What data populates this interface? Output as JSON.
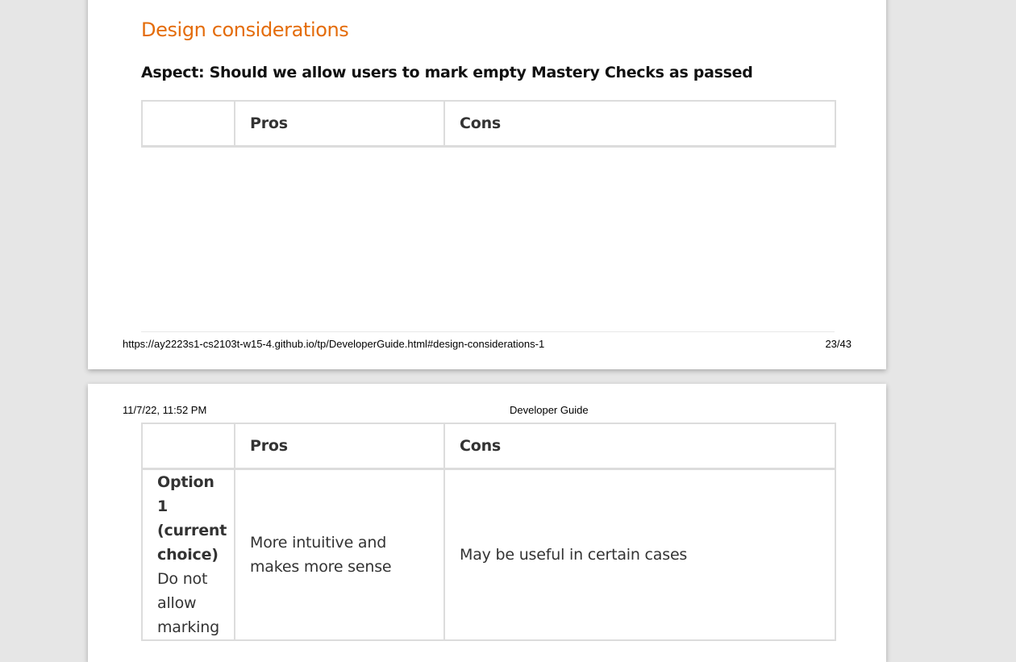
{
  "page1": {
    "section_heading": "Design considerations",
    "aspect_heading": "Aspect: Should we allow users to mark empty Mastery Checks as passed",
    "table_headers": [
      "",
      "Pros",
      "Cons"
    ],
    "footer_url": "https://ay2223s1-cs2103t-w15-4.github.io/tp/DeveloperGuide.html#design-considerations-1",
    "footer_page": "23/43"
  },
  "page2": {
    "header_date": "11/7/22, 11:52 PM",
    "header_title": "Developer Guide",
    "table_headers": [
      "",
      "Pros",
      "Cons"
    ],
    "rows": [
      {
        "option_name": "Option 1 (current choice)",
        "option_desc": "Do not allow marking",
        "pros": "More intuitive and makes more sense",
        "cons": "May be useful in certain cases"
      }
    ]
  }
}
